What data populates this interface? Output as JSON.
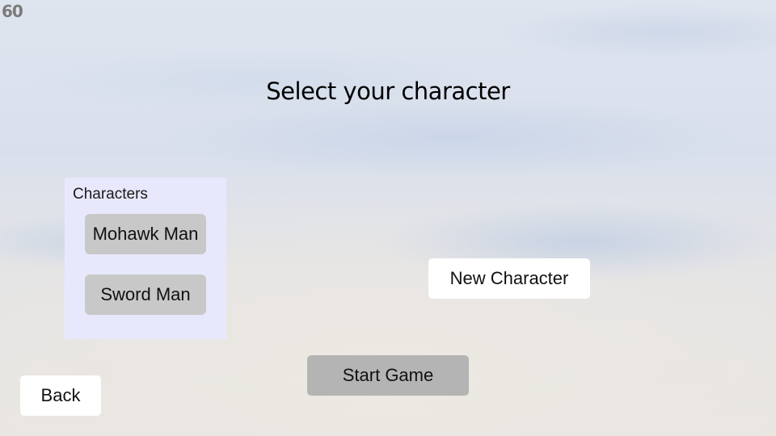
{
  "fps_overlay": "60",
  "title": "Select your character",
  "characters_panel": {
    "label": "Characters",
    "items": [
      "Mohawk Man",
      "Sword Man"
    ]
  },
  "buttons": {
    "new_character": "New Character",
    "start_game": "Start Game",
    "back": "Back"
  },
  "colors": {
    "panel_bg": "#e8e8fd",
    "character_button": "#c8c8c8",
    "start_button": "#b4b4b4",
    "white_button": "#ffffff"
  }
}
